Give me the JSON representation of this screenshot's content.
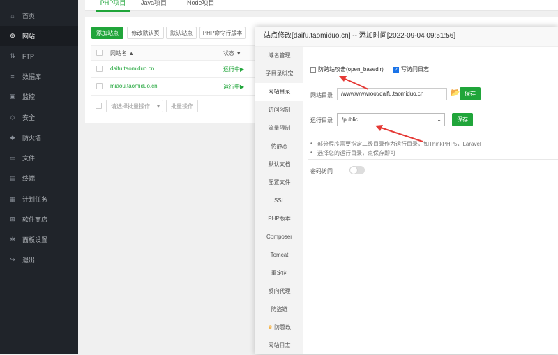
{
  "sidebar": {
    "items": [
      {
        "icon": "home-icon",
        "glyph": "⌂",
        "label": "首页"
      },
      {
        "icon": "globe-icon",
        "glyph": "⊕",
        "label": "网站"
      },
      {
        "icon": "ftp-icon",
        "glyph": "⇅",
        "label": "FTP"
      },
      {
        "icon": "database-icon",
        "glyph": "≡",
        "label": "数据库"
      },
      {
        "icon": "monitor-icon",
        "glyph": "▣",
        "label": "监控"
      },
      {
        "icon": "shield-icon",
        "glyph": "◇",
        "label": "安全"
      },
      {
        "icon": "firewall-icon",
        "glyph": "◆",
        "label": "防火墙"
      },
      {
        "icon": "folder-icon",
        "glyph": "▭",
        "label": "文件"
      },
      {
        "icon": "terminal-icon",
        "glyph": "▤",
        "label": "终端"
      },
      {
        "icon": "calendar-icon",
        "glyph": "▦",
        "label": "计划任务"
      },
      {
        "icon": "apps-icon",
        "glyph": "⊞",
        "label": "软件商店"
      },
      {
        "icon": "settings-icon",
        "glyph": "✲",
        "label": "面板设置"
      },
      {
        "icon": "logout-icon",
        "glyph": "↪",
        "label": "退出"
      }
    ]
  },
  "background": {
    "tabs": [
      "PHP项目",
      "Java项目",
      "Node项目"
    ],
    "buttons": {
      "add_site": "添加站点",
      "modify_default_page": "修改默认页",
      "default_site": "默认站点",
      "php_cli": "PHP命令行版本"
    },
    "table": {
      "col_name": "网站名 ▲",
      "col_status": "状态 ▼",
      "rows": [
        {
          "name": "daifu.taomiduo.cn",
          "status": "运行中▶"
        },
        {
          "name": "miaou.taomiduo.cn",
          "status": "运行中▶"
        }
      ]
    },
    "batch_select": "请选择批量操作",
    "batch_button": "批量操作"
  },
  "modal": {
    "title": "站点修改[daifu.taomiduo.cn] -- 添加时间[2022-09-04 09:51:56]",
    "menu": [
      "域名管理",
      "子目录绑定",
      "网站目录",
      "访问限制",
      "流量限制",
      "伪静态",
      "默认文档",
      "配置文件",
      "SSL",
      "PHP版本",
      "Composer",
      "Tomcat",
      "重定向",
      "反向代理",
      "防盗链",
      "防篡改",
      "网站日志"
    ],
    "active_menu": "网站目录",
    "content": {
      "anti_xss_label": "防跨站攻击(open_basedir)",
      "write_log_label": "写访问日志",
      "site_dir_label": "网站目录",
      "site_dir_value": "/www/wwwroot/daifu.taomiduo.cn",
      "save_label": "保存",
      "run_dir_label": "运行目录",
      "run_dir_value": "/public",
      "tips": [
        "部分程序需要指定二级目录作为运行目录，如ThinkPHP5，Laravel",
        "选择您的运行目录，点保存即可"
      ],
      "password_access_label": "密码访问"
    }
  },
  "colors": {
    "accent": "#20a53a",
    "sidebar_bg": "#20242a",
    "arrow": "#e53935",
    "checkbox_on": "#1a73e8"
  }
}
